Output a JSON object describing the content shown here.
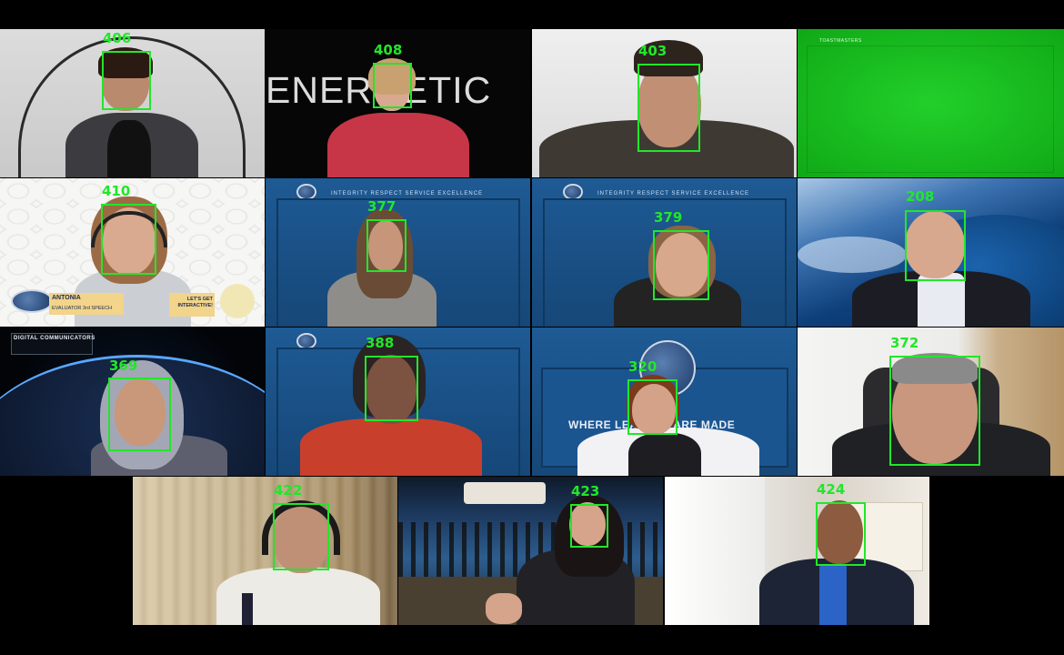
{
  "tiles": {
    "t1": {
      "face_id": "406"
    },
    "t2": {
      "face_id": "408",
      "bg_text": "ENERGETIC"
    },
    "t3": {
      "face_id": "403"
    },
    "t4": {
      "face_id": "",
      "bg_text": "TOASTMASTERS"
    },
    "t5": {
      "face_id": "410",
      "caption_name": "ANTONIA",
      "caption_role": "EVALUATOR 3rd SPEECH",
      "caption_cta": "LET'S GET INTERACTIVE!"
    },
    "t6": {
      "face_id": "377",
      "banner": "INTEGRITY   RESPECT   SERVICE   EXCELLENCE"
    },
    "t7": {
      "face_id": "379",
      "banner": "INTEGRITY   RESPECT   SERVICE   EXCELLENCE"
    },
    "t8": {
      "face_id": "208"
    },
    "t9": {
      "face_id": "369",
      "brand": "DIGITAL COMMUNICATORS"
    },
    "t10": {
      "face_id": "388"
    },
    "t11": {
      "face_id": "320",
      "tagline": "WHERE LEADERS ARE MADE"
    },
    "t12": {
      "face_id": "372"
    },
    "t13": {
      "face_id": "422"
    },
    "t14": {
      "face_id": "423"
    },
    "t15": {
      "face_id": "424"
    }
  },
  "colors": {
    "bbox": "#22e62a",
    "background": "#000000",
    "toastmasters_blue": "#1d4f86",
    "green_screen": "#16c21c"
  }
}
